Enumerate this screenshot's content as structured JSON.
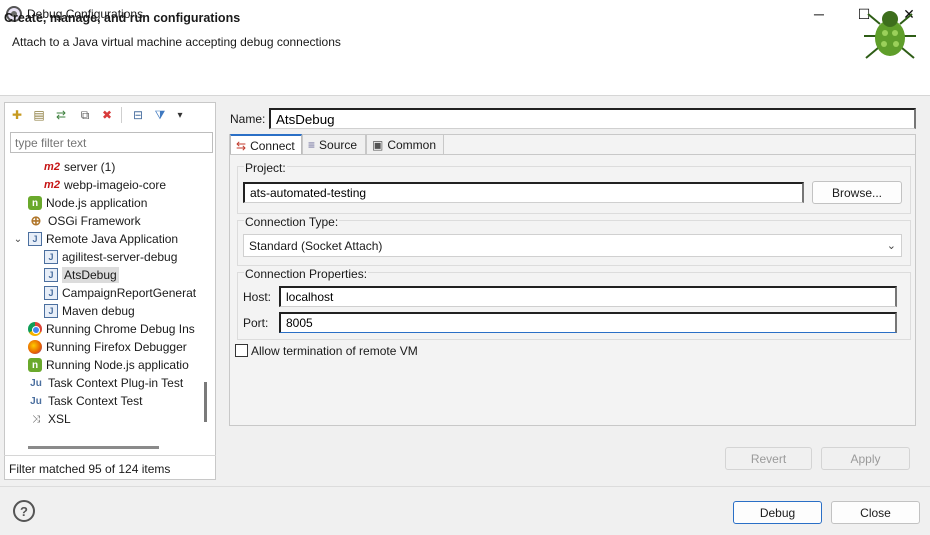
{
  "window": {
    "title": "Debug Configurations",
    "minimize": "─",
    "maximize": "☐",
    "close": "✕"
  },
  "header": {
    "title": "Create, manage, and run configurations",
    "subtitle": "Attach to a Java virtual machine accepting debug connections"
  },
  "sidebar": {
    "filter_placeholder": "type filter text",
    "items": [
      {
        "label": "server (1)",
        "icon": "m2-icon",
        "icon_text": "m2"
      },
      {
        "label": "webp-imageio-core",
        "icon": "m2-icon",
        "icon_text": "m2"
      },
      {
        "label": "Node.js application",
        "icon": "nodejs-icon",
        "icon_text": "n"
      },
      {
        "label": "OSGi Framework",
        "icon": "osgi-icon",
        "icon_text": "⊕"
      },
      {
        "label": "Remote Java Application",
        "icon": "remote-java-icon",
        "icon_text": "J",
        "expander": "⌄"
      },
      {
        "label": "agilitest-server-debug",
        "icon": "java-config-icon",
        "icon_text": "J"
      },
      {
        "label": "AtsDebug",
        "icon": "java-config-icon",
        "icon_text": "J"
      },
      {
        "label": "CampaignReportGenerat",
        "icon": "java-config-icon",
        "icon_text": "J"
      },
      {
        "label": "Maven debug",
        "icon": "java-config-icon",
        "icon_text": "J"
      },
      {
        "label": "Running Chrome Debug Ins",
        "icon": "chrome-icon",
        "icon_text": ""
      },
      {
        "label": "Running Firefox Debugger",
        "icon": "firefox-icon",
        "icon_text": ""
      },
      {
        "label": "Running Node.js applicatio",
        "icon": "nodejs-icon",
        "icon_text": "n"
      },
      {
        "label": "Task Context Plug-in Test",
        "icon": "junit-plugin-icon",
        "icon_text": "Ju"
      },
      {
        "label": "Task Context Test",
        "icon": "junit-icon",
        "icon_text": "Ju"
      },
      {
        "label": "XSL",
        "icon": "xsl-icon",
        "icon_text": "⤨"
      }
    ],
    "filter_status": "Filter matched 95 of 124 items"
  },
  "toolbar": {
    "new_icon": "✚",
    "new_proto_icon": "▤",
    "export_icon": "⇄",
    "duplicate_icon": "⧉",
    "delete_icon": "✖",
    "collapse_icon": "⊟",
    "filter_icon": "⧩",
    "menu_icon": "▾"
  },
  "config": {
    "name_label": "Name:",
    "name_value": "AtsDebug",
    "tabs": [
      {
        "label": "Connect",
        "icon": "⇆"
      },
      {
        "label": "Source",
        "icon": "≡"
      },
      {
        "label": "Common",
        "icon": "▣"
      }
    ],
    "project_label": "Project:",
    "project_value": "ats-automated-testing",
    "browse_label": "Browse...",
    "connection_type_label": "Connection Type:",
    "connection_type_value": "Standard (Socket Attach)",
    "connection_props_label": "Connection Properties:",
    "host_label": "Host:",
    "host_value": "localhost",
    "port_label": "Port:",
    "port_value": "8005",
    "allow_termination_label": "Allow termination of remote VM",
    "revert_label": "Revert",
    "apply_label": "Apply"
  },
  "footer": {
    "help_icon": "?",
    "debug_label": "Debug",
    "close_label": "Close"
  },
  "colors": {
    "accent": "#2a6fc6",
    "m2": "#c61414",
    "node": "#6aa92c",
    "delete": "#d83b3b"
  }
}
